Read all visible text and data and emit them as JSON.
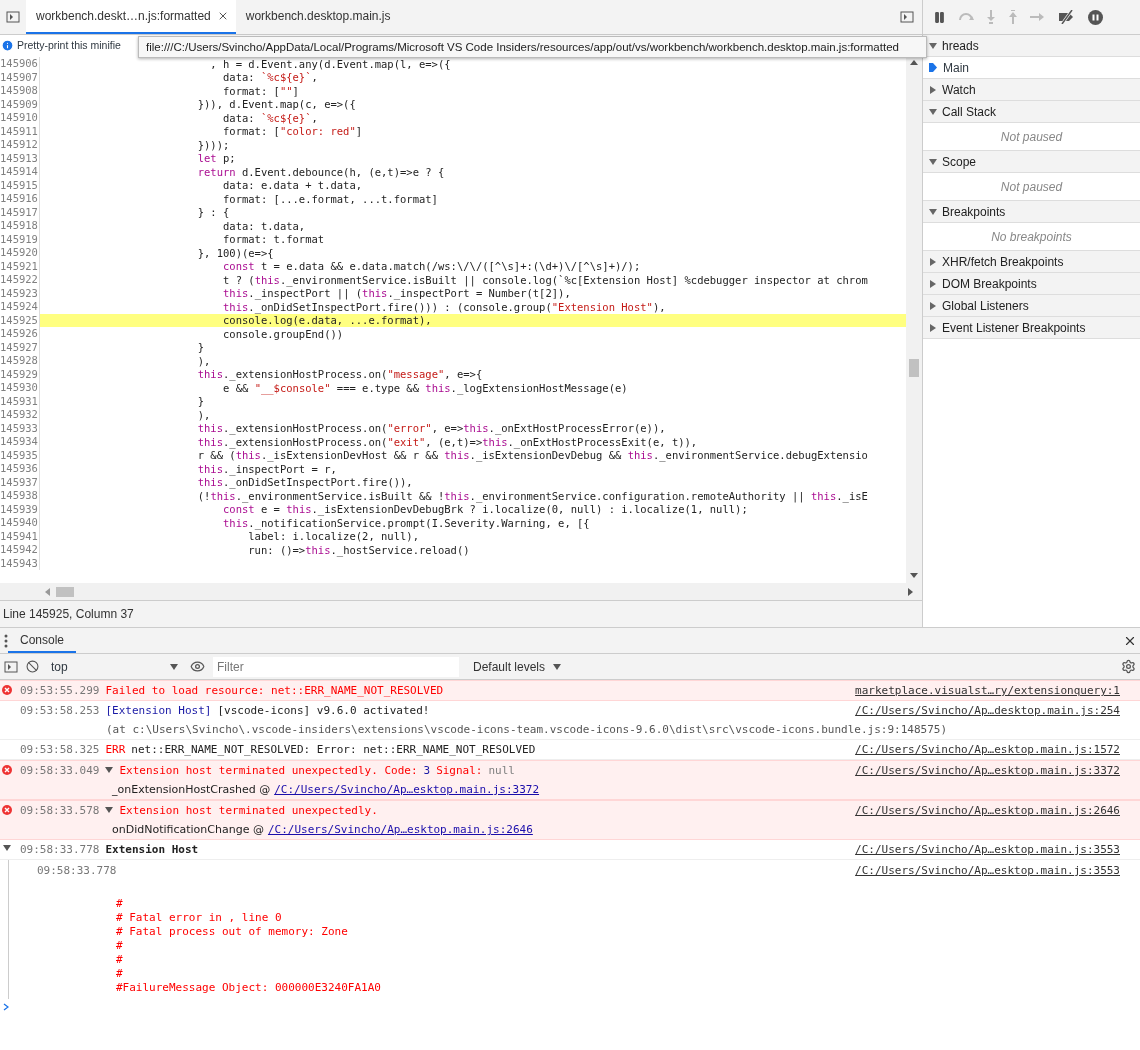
{
  "editor_tabs": [
    {
      "label": "workbench.deskt…n.js:formatted",
      "selected": true,
      "closable": true
    },
    {
      "label": "workbench.desktop.main.js",
      "selected": false,
      "closable": false
    }
  ],
  "info_bar": {
    "text": "Pretty-print this minifie"
  },
  "tooltip": {
    "text": "file:///C:/Users/Svincho/AppData/Local/Programs/Microsoft VS Code Insiders/resources/app/out/vs/workbench/workbench.desktop.main.js:formatted"
  },
  "code_lines": [
    {
      "number": "145906",
      "text": "                          , h = d.Event.any(d.Event.map(l, e=>({",
      "highlighted": false
    },
    {
      "number": "145907",
      "text": "                            data: `%c${e}`,",
      "highlighted": false
    },
    {
      "number": "145908",
      "text": "                            format: [\"\"]",
      "highlighted": false
    },
    {
      "number": "145909",
      "text": "                        })), d.Event.map(c, e=>({",
      "highlighted": false
    },
    {
      "number": "145910",
      "text": "                            data: `%c${e}`,",
      "highlighted": false
    },
    {
      "number": "145911",
      "text": "                            format: [\"color: red\"]",
      "highlighted": false
    },
    {
      "number": "145912",
      "text": "                        })));",
      "highlighted": false
    },
    {
      "number": "145913",
      "text": "                        let p;",
      "highlighted": false
    },
    {
      "number": "145914",
      "text": "                        return d.Event.debounce(h, (e,t)=>e ? {",
      "highlighted": false
    },
    {
      "number": "145915",
      "text": "                            data: e.data + t.data,",
      "highlighted": false
    },
    {
      "number": "145916",
      "text": "                            format: [...e.format, ...t.format]",
      "highlighted": false
    },
    {
      "number": "145917",
      "text": "                        } : {",
      "highlighted": false
    },
    {
      "number": "145918",
      "text": "                            data: t.data,",
      "highlighted": false
    },
    {
      "number": "145919",
      "text": "                            format: t.format",
      "highlighted": false
    },
    {
      "number": "145920",
      "text": "                        }, 100)(e=>{",
      "highlighted": false
    },
    {
      "number": "145921",
      "text": "                            const t = e.data && e.data.match(/ws:\\/\\/([^\\s]+:(\\d+)\\/[^\\s]+)/);",
      "highlighted": false
    },
    {
      "number": "145922",
      "text": "                            t ? (this._environmentService.isBuilt || console.log(`%c[Extension Host] %cdebugger inspector at chrom",
      "highlighted": false
    },
    {
      "number": "145923",
      "text": "                            this._inspectPort || (this._inspectPort = Number(t[2]),",
      "highlighted": false
    },
    {
      "number": "145924",
      "text": "                            this._onDidSetInspectPort.fire())) : (console.group(\"Extension Host\"),",
      "highlighted": false
    },
    {
      "number": "145925",
      "text": "                            console.log(e.data, ...e.format),",
      "highlighted": true
    },
    {
      "number": "145926",
      "text": "                            console.groupEnd())",
      "highlighted": false
    },
    {
      "number": "145927",
      "text": "                        }",
      "highlighted": false
    },
    {
      "number": "145928",
      "text": "                        ),",
      "highlighted": false
    },
    {
      "number": "145929",
      "text": "                        this._extensionHostProcess.on(\"message\", e=>{",
      "highlighted": false
    },
    {
      "number": "145930",
      "text": "                            e && \"__$console\" === e.type && this._logExtensionHostMessage(e)",
      "highlighted": false
    },
    {
      "number": "145931",
      "text": "                        }",
      "highlighted": false
    },
    {
      "number": "145932",
      "text": "                        ),",
      "highlighted": false
    },
    {
      "number": "145933",
      "text": "                        this._extensionHostProcess.on(\"error\", e=>this._onExtHostProcessError(e)),",
      "highlighted": false
    },
    {
      "number": "145934",
      "text": "                        this._extensionHostProcess.on(\"exit\", (e,t)=>this._onExtHostProcessExit(e, t)),",
      "highlighted": false
    },
    {
      "number": "145935",
      "text": "                        r && (this._isExtensionDevHost && r && this._isExtensionDevDebug && this._environmentService.debugExtensio",
      "highlighted": false
    },
    {
      "number": "145936",
      "text": "                        this._inspectPort = r,",
      "highlighted": false
    },
    {
      "number": "145937",
      "text": "                        this._onDidSetInspectPort.fire()),",
      "highlighted": false
    },
    {
      "number": "145938",
      "text": "                        (!this._environmentService.isBuilt && !this._environmentService.configuration.remoteAuthority || this._isE",
      "highlighted": false
    },
    {
      "number": "145939",
      "text": "                            const e = this._isExtensionDevDebugBrk ? i.localize(0, null) : i.localize(1, null);",
      "highlighted": false
    },
    {
      "number": "145940",
      "text": "                            this._notificationService.prompt(I.Severity.Warning, e, [{",
      "highlighted": false
    },
    {
      "number": "145941",
      "text": "                                label: i.localize(2, null),",
      "highlighted": false
    },
    {
      "number": "145942",
      "text": "                                run: ()=>this._hostService.reload()",
      "highlighted": false
    },
    {
      "number": "145943",
      "highlighted": false
    }
  ],
  "status_bar": {
    "text": "Line 145925, Column 37"
  },
  "sidebar": {
    "sections": [
      {
        "title": "hreads",
        "expanded": true,
        "items": [
          {
            "label": "Main",
            "selected": true
          }
        ]
      },
      {
        "title": "Watch",
        "expanded": false
      },
      {
        "title": "Call Stack",
        "expanded": true,
        "empty_text": "Not paused"
      },
      {
        "title": "Scope",
        "expanded": true,
        "empty_text": "Not paused"
      },
      {
        "title": "Breakpoints",
        "expanded": true,
        "empty_text": "No breakpoints"
      },
      {
        "title": "XHR/fetch Breakpoints",
        "expanded": false
      },
      {
        "title": "DOM Breakpoints",
        "expanded": false
      },
      {
        "title": "Global Listeners",
        "expanded": false
      },
      {
        "title": "Event Listener Breakpoints",
        "expanded": false
      }
    ]
  },
  "drawer": {
    "tabs": [
      {
        "label": "Console",
        "selected": true
      }
    ],
    "context": "top",
    "filter": {
      "placeholder": "Filter"
    },
    "levels": "Default levels"
  },
  "messages": [
    {
      "kind": "error",
      "time": "09:53:55.299",
      "parts": [
        {
          "text": "Failed to load resource: net::ERR_NAME_NOT_RESOLVED",
          "color": "#ff0000"
        }
      ],
      "source": "marketplace.visualst…ry/extensionquery:1"
    },
    {
      "kind": "log",
      "time": "09:53:58.253",
      "parts": [
        {
          "text": "[Extension Host]",
          "color": "#1a1aa6"
        },
        {
          "text": "[vscode-icons] v9.6.0 activated!",
          "color": "#222222"
        }
      ],
      "detail": "(at c:\\Users\\Svincho\\.vscode-insiders\\extensions\\vscode-icons-team.vscode-icons-9.6.0\\dist\\src\\vscode-icons.bundle.js:9:148575)",
      "source": "/C:/Users/Svincho/Ap…desktop.main.js:254"
    },
    {
      "kind": "log",
      "time": "09:53:58.325",
      "parts": [
        {
          "text": "ERR",
          "color": "#ff0000"
        },
        {
          "text": "net::ERR_NAME_NOT_RESOLVED: Error: net::ERR_NAME_NOT_RESOLVED",
          "color": "#222222"
        }
      ],
      "source": "/C:/Users/Svincho/Ap…esktop.main.js:1572"
    },
    {
      "kind": "error",
      "time": "09:58:33.049",
      "expanded": true,
      "parts": [
        {
          "text": "Extension host terminated unexpectedly. Code:",
          "color": "#ff0000"
        },
        {
          "text": "3",
          "color": "#1a1aa6"
        },
        {
          "text": "Signal:",
          "color": "#ff0000"
        },
        {
          "text": "null",
          "color": "#808080"
        }
      ],
      "stack": {
        "fn": "_onExtensionHostCrashed @",
        "link": "/C:/Users/Svincho/Ap…esktop.main.js:3372"
      },
      "source": "/C:/Users/Svincho/Ap…esktop.main.js:3372"
    },
    {
      "kind": "error",
      "time": "09:58:33.578",
      "expanded": true,
      "parts": [
        {
          "text": "Extension host terminated unexpectedly.",
          "color": "#ff0000"
        }
      ],
      "stack": {
        "fn": "onDidNotificationChange @",
        "link": "/C:/Users/Svincho/Ap…esktop.main.js:2646"
      },
      "source": "/C:/Users/Svincho/Ap…esktop.main.js:2646"
    },
    {
      "kind": "group",
      "time": "09:58:33.778",
      "expanded": true,
      "title": "Extension Host",
      "source": "/C:/Users/Svincho/Ap…esktop.main.js:3553",
      "children": [
        {
          "time": "09:58:33.778",
          "source": "/C:/Users/Svincho/Ap…esktop.main.js:3553",
          "lines": [
            "#",
            "# Fatal error in , line 0",
            "# Fatal process out of memory: Zone",
            "#",
            "#",
            "#",
            "#FailureMessage Object: 000000E3240FA1A0"
          ]
        }
      ]
    }
  ]
}
